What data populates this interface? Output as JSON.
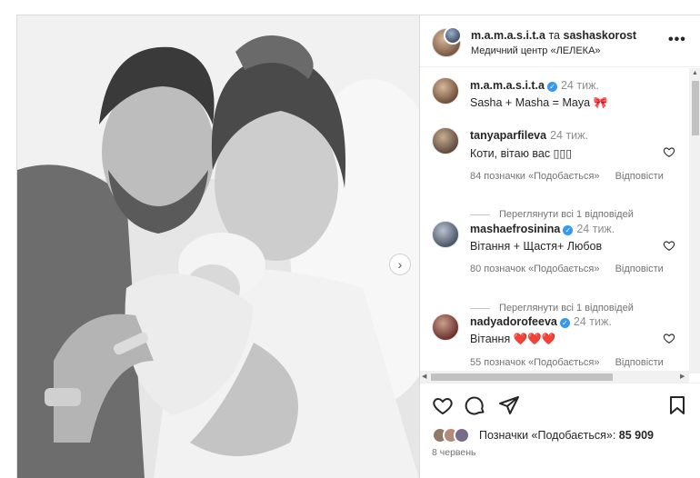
{
  "header": {
    "user1": "m.a.m.a.s.i.t.a",
    "conjunction": "та",
    "user2": "sashaskorost",
    "location": "Медичний центр «ЛЕЛЕКА»"
  },
  "caption": {
    "user": "m.a.m.a.s.i.t.a",
    "time": "24 тиж.",
    "text": "Sasha + Masha = Maya 🎀"
  },
  "comments": [
    {
      "user": "tanyaparfileva",
      "verified": false,
      "time": "24 тиж.",
      "text": "Коти, вітаю вас ▯▯▯",
      "likes": "84 позначки «Подобається»",
      "reply": "Відповісти",
      "view_replies": "Переглянути всі 1 відповідей",
      "avatar_color": "#8a6b55"
    },
    {
      "user": "mashaefrosinina",
      "verified": true,
      "time": "24 тиж.",
      "text": "Вітання + Щастя+ Любов",
      "likes": "80 позначок «Подобається»",
      "reply": "Відповісти",
      "view_replies": "Переглянути всі 1 відповідей",
      "avatar_color": "#6b7f99"
    },
    {
      "user": "nadyadorofeeva",
      "verified": true,
      "time": "24 тиж.",
      "text": "Вітання ❤️❤️❤️",
      "likes": "55 позначок «Подобається»",
      "reply": "Відповісти",
      "view_replies": "",
      "avatar_color": "#a04848"
    }
  ],
  "likes": {
    "label": "Позначки «Подобається»:",
    "count": "85 909"
  },
  "date": "8 червень",
  "icons": {
    "more": "more-options-icon",
    "like": "heart-icon",
    "comment": "comment-icon",
    "share": "send-icon",
    "save": "bookmark-icon",
    "next": "chevron-right-icon"
  },
  "colors": {
    "text": "#262626",
    "muted": "#737373",
    "verified": "#3897f0",
    "border": "#dbdbdb"
  }
}
